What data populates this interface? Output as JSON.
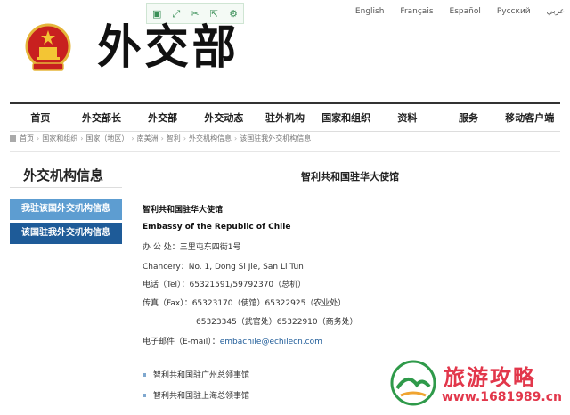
{
  "toolbar": {
    "icons": [
      "bookmark-icon",
      "expand-icon",
      "cut-icon",
      "share-icon",
      "settings-icon"
    ],
    "glyphs": [
      "▣",
      "⤢",
      "✂",
      "⇱",
      "⚙"
    ]
  },
  "languages": [
    "English",
    "Français",
    "Español",
    "Русский",
    "عربي"
  ],
  "header": {
    "calligraphy": "外交部"
  },
  "nav": [
    "首页",
    "外交部长",
    "外交部",
    "外交动态",
    "驻外机构",
    "国家和组织",
    "资料",
    "服务",
    "移动客户端"
  ],
  "breadcrumb": [
    "首页",
    "国家和组织",
    "国家（地区）",
    "南美洲",
    "智利",
    "外交机构信息",
    "该国驻我外交机构信息"
  ],
  "sidebar": {
    "title": "外交机构信息",
    "items": [
      "我驻该国外交机构信息",
      "该国驻我外交机构信息"
    ]
  },
  "content": {
    "title": "智利共和国驻华大使馆",
    "name_cn": "智利共和国驻华大使馆",
    "name_en": "Embassy of the Republic of Chile",
    "address_cn": "办  公  处：三里屯东四街1号",
    "address_en": "Chancery：No. 1, Dong Si Jie, San Li Tun",
    "phone": "电话（Tel）：65321591/59792370（总机）",
    "fax_1": "传真（Fax）：65323170（使馆）65322925（农业处）",
    "fax_2": "65323345（武官处）65322910（商务处）",
    "email_label": "电子邮件（E-mail）：",
    "email": "embachile@echilecn.com",
    "links": [
      "智利共和国驻广州总领事馆",
      "智利共和国驻上海总领事馆"
    ]
  },
  "watermark": {
    "title": "旅游攻略",
    "url": "www.1681989.cn"
  },
  "colors": {
    "sidebar_light": "#5d9dd1",
    "sidebar_dark": "#1e5b98",
    "watermark": "#e2374b"
  }
}
